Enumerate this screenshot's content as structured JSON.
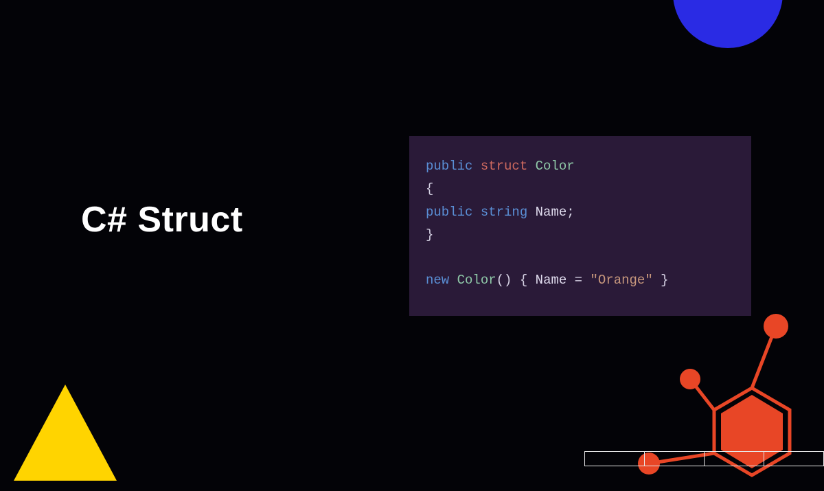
{
  "title": "C# Struct",
  "code": {
    "line1": {
      "t1": "public",
      "t2": "struct",
      "t3": "Color"
    },
    "line2": "{",
    "line3": {
      "indent": "    ",
      "t1": "public",
      "t2": "string",
      "t3": "Name",
      "semi": ";"
    },
    "line4": "}",
    "blank": "",
    "line5": {
      "t1": "new",
      "t2": "Color",
      "paren": "()",
      "space": " ",
      "ob": "{",
      "prop": "Name",
      "eq": " = ",
      "str": "\"Orange\"",
      "cb": "}"
    }
  },
  "colors": {
    "blue_accent": "#2a2be4",
    "yellow_accent": "#ffd400",
    "red_accent": "#e84626"
  }
}
